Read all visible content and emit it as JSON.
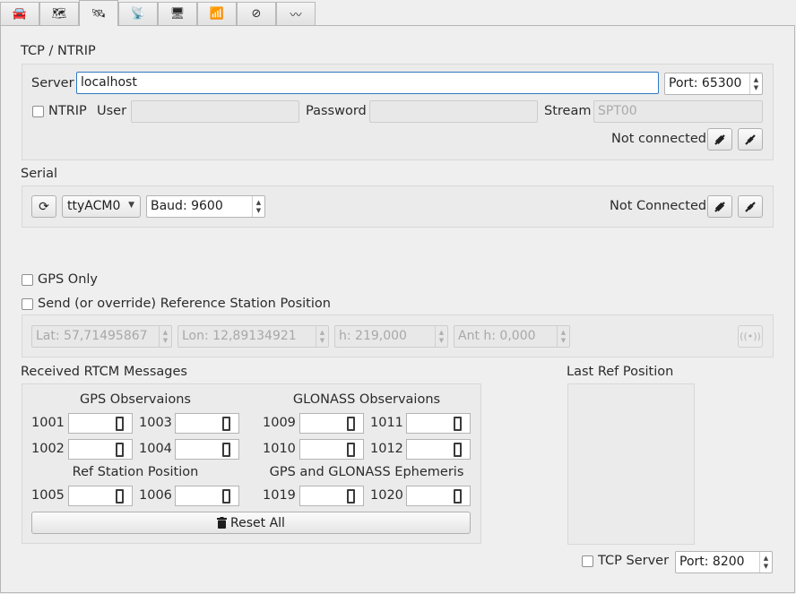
{
  "tabs": [
    {
      "icon": "car-icon",
      "glyph": "🚘"
    },
    {
      "icon": "map-icon",
      "glyph": "🗺"
    },
    {
      "icon": "satellite-icon",
      "glyph": "🛰"
    },
    {
      "icon": "satellite-dish-icon",
      "glyph": "📡"
    },
    {
      "icon": "monitor-icon",
      "glyph": "🖥"
    },
    {
      "icon": "antenna-icon",
      "glyph": "📶"
    },
    {
      "icon": "no-signal-icon",
      "glyph": "⊘"
    },
    {
      "icon": "waveform-icon",
      "glyph": "〰"
    }
  ],
  "tcp": {
    "title": "TCP / NTRIP",
    "server_label": "Server",
    "server_value": "localhost",
    "port": "Port: 65300",
    "ntrip_label": "NTRIP",
    "ntrip_checked": false,
    "user_label": "User",
    "user_value": "",
    "password_label": "Password",
    "password_value": "",
    "stream_label": "Stream",
    "stream_placeholder": "SPT00",
    "status": "Not connected",
    "connect_icon": "plug-connect-icon",
    "disconnect_icon": "plug-disconnect-icon"
  },
  "serial": {
    "title": "Serial",
    "refresh_icon": "refresh-icon",
    "device": "ttyACM0",
    "baud": "Baud: 9600",
    "status": "Not Connected"
  },
  "options": {
    "gps_only_label": "GPS Only",
    "gps_only_checked": false,
    "send_ref_label": "Send (or override) Reference Station Position",
    "send_ref_checked": false
  },
  "ref_position": {
    "lat": "Lat: 57,71495867",
    "lon": "Lon: 12,89134921",
    "h": "h: 219,000",
    "ant_h": "Ant h: 0,000",
    "antenna_icon": "antenna-icon"
  },
  "rtcm": {
    "title": "Received RTCM Messages",
    "gps_obs_title": "GPS Observaions",
    "glonass_obs_title": "GLONASS Observaions",
    "ref_station_title": "Ref Station Position",
    "ephemeris_title": "GPS and GLONASS Ephemeris",
    "messages": [
      {
        "id": "1001",
        "count": "0"
      },
      {
        "id": "1003",
        "count": "0"
      },
      {
        "id": "1009",
        "count": "0"
      },
      {
        "id": "1011",
        "count": "0"
      },
      {
        "id": "1002",
        "count": "0"
      },
      {
        "id": "1004",
        "count": "0"
      },
      {
        "id": "1010",
        "count": "0"
      },
      {
        "id": "1012",
        "count": "0"
      },
      {
        "id": "1005",
        "count": "0"
      },
      {
        "id": "1006",
        "count": "0"
      },
      {
        "id": "1019",
        "count": "0"
      },
      {
        "id": "1020",
        "count": "0"
      }
    ],
    "reset_label": "Reset All",
    "reset_icon": "trash-icon"
  },
  "last_ref": {
    "title": "Last Ref Position"
  },
  "tcp_server": {
    "label": "TCP Server",
    "checked": false,
    "port": "Port: 8200"
  },
  "colors": {
    "background": "#efefef",
    "focus_border": "#2f7ac1",
    "group_background": "#ebebeb"
  }
}
